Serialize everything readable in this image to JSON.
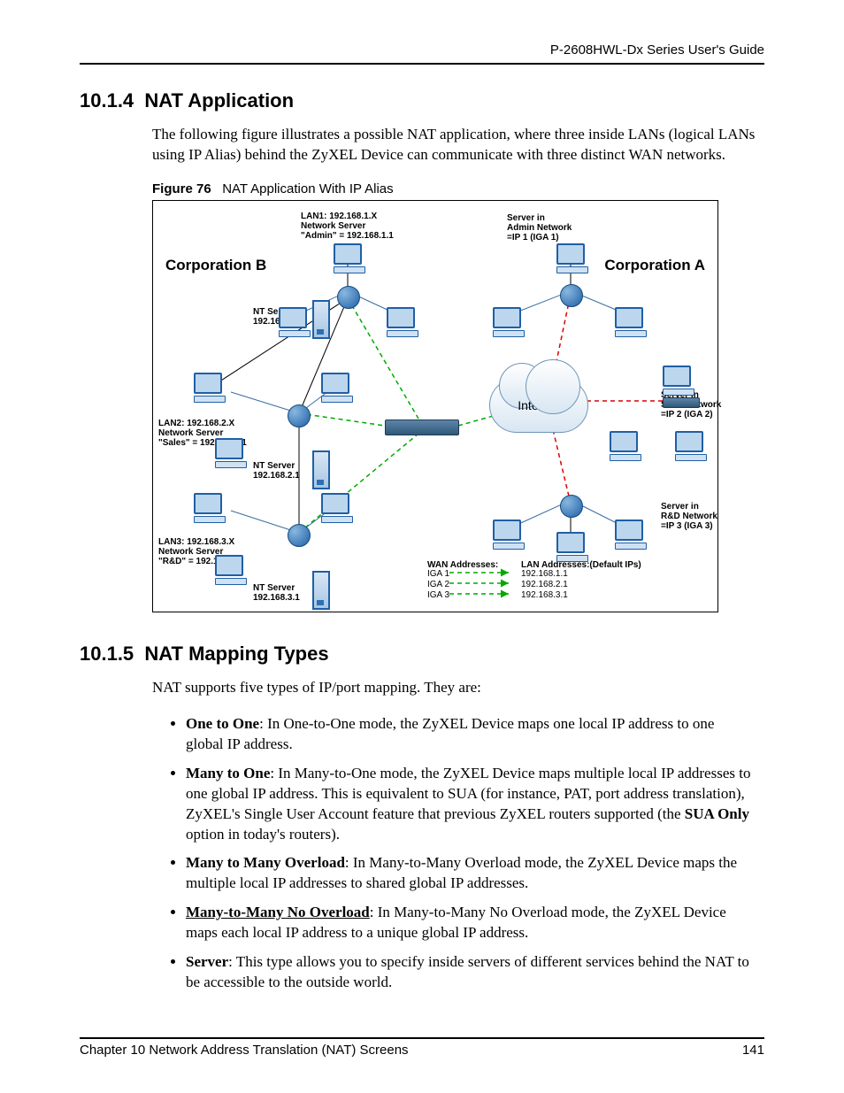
{
  "header": {
    "guide_title": "P-2608HWL-Dx Series User's Guide"
  },
  "section1": {
    "number": "10.1.4",
    "title": "NAT Application",
    "paragraph": "The following figure illustrates a possible NAT application, where three inside LANs (logical LANs using IP Alias) behind the ZyXEL Device can communicate with three distinct WAN networks."
  },
  "figure": {
    "number": "Figure 76",
    "caption": "NAT Application With IP Alias",
    "labels": {
      "lan1_block": "LAN1: 192.168.1.X\nNetwork Server\n\"Admin\" = 192.168.1.1",
      "admin_server": "Server in\nAdmin Network\n=IP 1 (IGA 1)",
      "corp_b": "Corporation B",
      "corp_a": "Corporation A",
      "nt_server_1": "NT Server\n192.168.1.1",
      "lan2_block": "LAN2: 192.168.2.X\nNetwork Server\n\"Sales\" = 192.168.2.1",
      "sales_server": "Server in\nSales Network\n=IP 2 (IGA 2)",
      "nt_server_2": "NT Server\n192.168.2.1",
      "lan3_block": "LAN3: 192.168.3.X\nNetwork Server\n\"R&D\" = 192.168.3.1",
      "rd_server": "Server in\nR&D Network\n=IP 3 (IGA 3)",
      "nt_server_3": "NT Server\n192.168.3.1",
      "internet": "Internet",
      "wan_addr_head": "WAN Addresses:",
      "lan_addr_head": "LAN Addresses:(Default IPs)",
      "iga1_l": "IGA 1",
      "iga2_l": "IGA 2",
      "iga3_l": "IGA 3",
      "iga1_r": "192.168.1.1",
      "iga2_r": "192.168.2.1",
      "iga3_r": "192.168.3.1"
    }
  },
  "section2": {
    "number": "10.1.5",
    "title": "NAT Mapping Types",
    "intro": "NAT supports five types of IP/port mapping. They are:",
    "items": [
      {
        "head": "One to One",
        "body": ": In One-to-One mode, the ZyXEL Device maps one local IP address to one global IP address."
      },
      {
        "head": "Many to One",
        "body_pre": ": In Many-to-One mode, the ZyXEL Device maps multiple local IP addresses to one global IP address. This is equivalent to SUA (for instance, PAT, port address translation), ZyXEL's Single User Account feature that previous ZyXEL routers supported (the ",
        "sua": "SUA Only",
        "body_post": " option in today's routers)."
      },
      {
        "head": "Many to Many Overload",
        "body": ": In Many-to-Many Overload mode, the ZyXEL Device maps the multiple local IP addresses to shared global IP addresses."
      },
      {
        "head": "Many-to-Many No Overload",
        "underline": true,
        "body": ": In Many-to-Many No Overload mode, the ZyXEL Device maps each local IP address to a unique global IP address."
      },
      {
        "head": "Server",
        "body": ": This type allows you to specify inside servers of different services behind the NAT to be accessible to the outside world."
      }
    ]
  },
  "footer": {
    "chapter": "Chapter 10 Network Address Translation (NAT) Screens",
    "page": "141"
  }
}
